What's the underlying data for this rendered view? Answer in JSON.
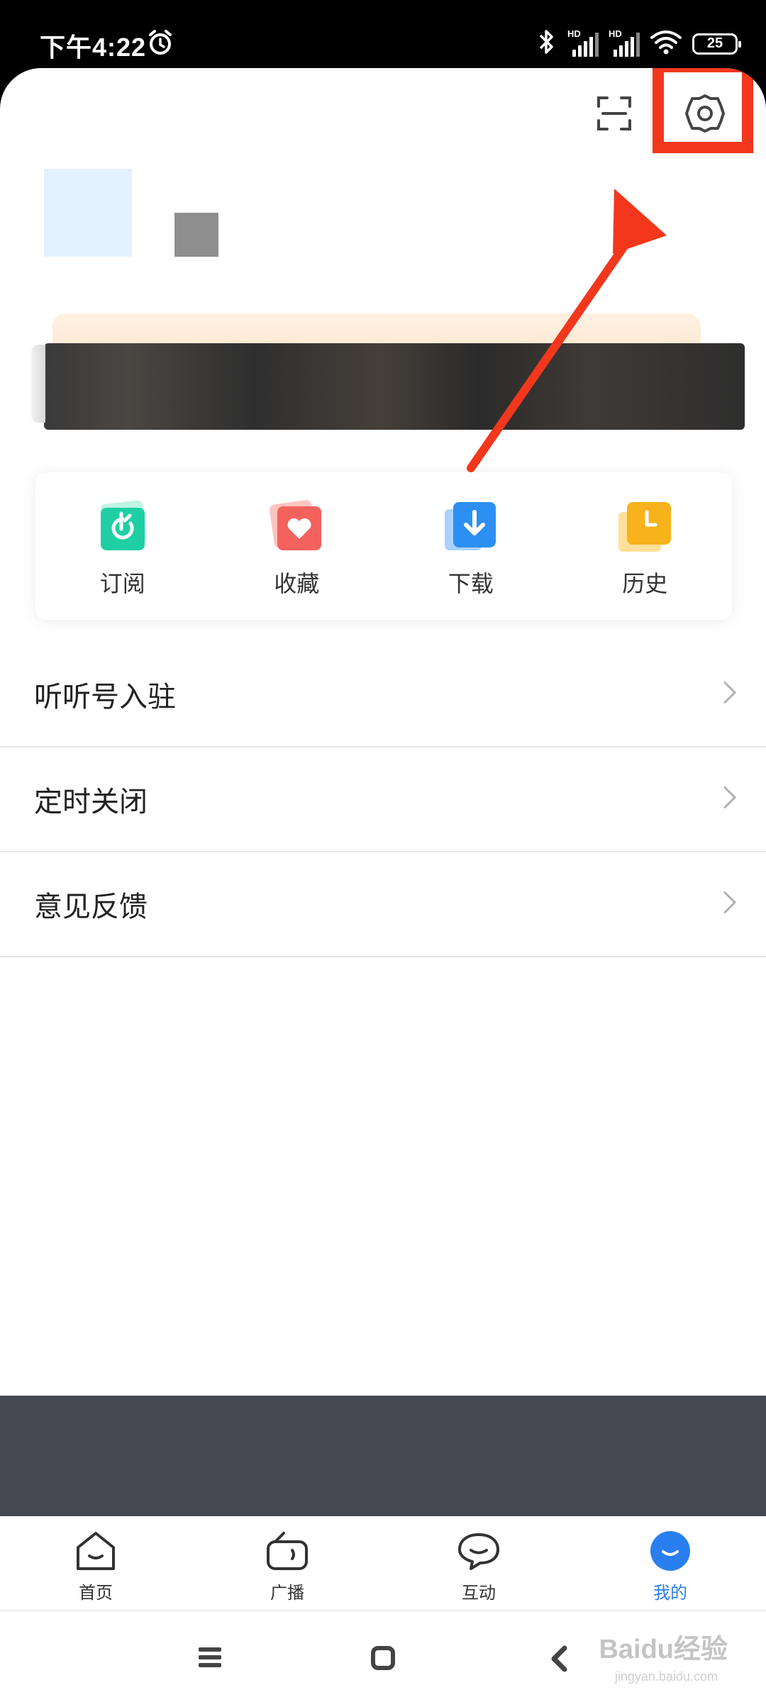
{
  "status_bar": {
    "time": "下午4:22",
    "network_label_1": "HD",
    "network_label_2": "HD",
    "battery_level": "25"
  },
  "header": {
    "scan_icon": "scan-icon",
    "settings_icon": "gear-icon",
    "highlight_color": "#f2371c"
  },
  "quick_actions": [
    {
      "label": "订阅",
      "icon": "subscribe-icon",
      "color": "#1ecfa4"
    },
    {
      "label": "收藏",
      "icon": "favorite-icon",
      "color": "#f3625d"
    },
    {
      "label": "下载",
      "icon": "download-icon",
      "color": "#2c8ff2"
    },
    {
      "label": "历史",
      "icon": "history-icon",
      "color": "#f7b21c"
    }
  ],
  "menu": [
    {
      "label": "听听号入驻"
    },
    {
      "label": "定时关闭"
    },
    {
      "label": "意见反馈"
    }
  ],
  "bottom_nav": [
    {
      "label": "首页",
      "icon": "home-icon"
    },
    {
      "label": "广播",
      "icon": "radio-icon"
    },
    {
      "label": "互动",
      "icon": "chat-icon"
    },
    {
      "label": "我的",
      "icon": "profile-icon",
      "active": true
    }
  ],
  "accent_color": "#2a7ff0",
  "watermark": {
    "text": "Baidu经验",
    "sub": "jingyan.baidu.com"
  }
}
